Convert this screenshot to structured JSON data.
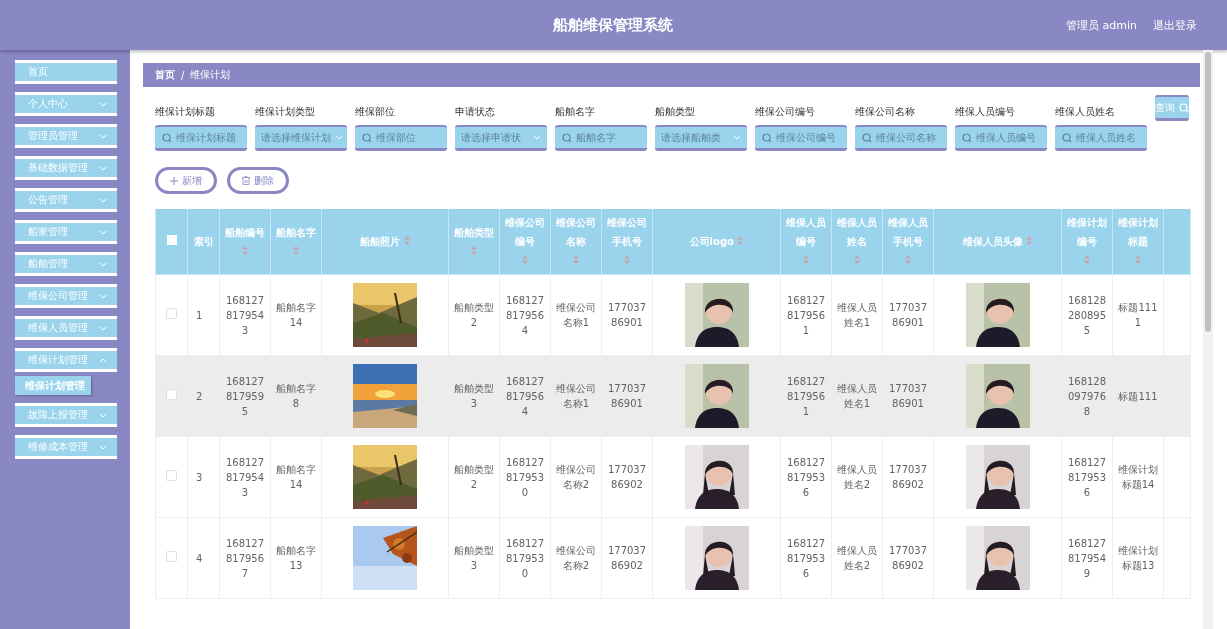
{
  "header": {
    "title": "船舶维保管理系统",
    "user": "管理员 admin",
    "logout": "退出登录"
  },
  "sidebar": {
    "items": [
      {
        "label": "首页",
        "kind": "link"
      },
      {
        "label": "个人中心",
        "kind": "group",
        "expanded": false
      },
      {
        "label": "管理员管理",
        "kind": "group",
        "expanded": false
      },
      {
        "label": "基础数据管理",
        "kind": "group",
        "expanded": false
      },
      {
        "label": "公告管理",
        "kind": "group",
        "expanded": false
      },
      {
        "label": "船家管理",
        "kind": "group",
        "expanded": false
      },
      {
        "label": "船舶管理",
        "kind": "group",
        "expanded": false
      },
      {
        "label": "维保公司管理",
        "kind": "group",
        "expanded": false
      },
      {
        "label": "维保人员管理",
        "kind": "group",
        "expanded": false
      },
      {
        "label": "维保计划管理",
        "kind": "group",
        "expanded": true,
        "children": [
          {
            "label": "维保计划管理",
            "selected": true
          }
        ]
      },
      {
        "label": "故障上报管理",
        "kind": "group",
        "expanded": false
      },
      {
        "label": "维修成本管理",
        "kind": "group",
        "expanded": false
      }
    ]
  },
  "breadcrumb": {
    "items": [
      "首页",
      "维保计划"
    ],
    "separator": "/"
  },
  "filters": [
    {
      "label": "维保计划标题",
      "kind": "input",
      "placeholder": "维保计划标题"
    },
    {
      "label": "维保计划类型",
      "kind": "select",
      "placeholder": "请选择维保计划"
    },
    {
      "label": "维保部位",
      "kind": "input",
      "placeholder": "维保部位"
    },
    {
      "label": "申请状态",
      "kind": "select",
      "placeholder": "请选择申请状"
    },
    {
      "label": "船舶名字",
      "kind": "input",
      "placeholder": "船舶名字"
    },
    {
      "label": "船舶类型",
      "kind": "select",
      "placeholder": "请选择船舶类"
    },
    {
      "label": "维保公司编号",
      "kind": "input",
      "placeholder": "维保公司编号"
    },
    {
      "label": "维保公司名称",
      "kind": "input",
      "placeholder": "维保公司名称"
    },
    {
      "label": "维保人员编号",
      "kind": "input",
      "placeholder": "维保人员编号"
    },
    {
      "label": "维保人员姓名",
      "kind": "input",
      "placeholder": "维保人员姓名"
    }
  ],
  "search_button": "查询",
  "actions": [
    {
      "label": "新增",
      "kind": "add"
    },
    {
      "label": "删除",
      "kind": "delete"
    }
  ],
  "table": {
    "select_all_checked": false,
    "index_header": "索引",
    "columns": [
      {
        "kind": "text",
        "label": "船舶编号"
      },
      {
        "kind": "text",
        "label": "船舶名字"
      },
      {
        "label": "船舶照片"
      },
      {
        "kind": "text",
        "label": "船舶类型"
      },
      {
        "kind": "text",
        "label": "维保公司编号"
      },
      {
        "kind": "text",
        "label": "维保公司名称"
      },
      {
        "kind": "text",
        "label": "维保公司手机号"
      },
      {
        "kind": "avatar",
        "label": "公司logo"
      },
      {
        "kind": "text",
        "label": "维保人员编号"
      },
      {
        "kind": "text",
        "label": "维保人员姓名"
      },
      {
        "kind": "text",
        "label": "维保人员手机号"
      },
      {
        "kind": "avatar",
        "label": "维保人员头像"
      },
      {
        "kind": "text",
        "label": "维保计划编号"
      },
      {
        "kind": "text",
        "label": "维保计划标题"
      }
    ],
    "rows": [
      {
        "index": "1",
        "checked": false,
        "highlighted": false,
        "cells": [
          "1681278179543",
          "船舶名字14",
          {
            "kind": "picture"
          },
          "船舶类型2",
          "1681278179564",
          "维保公司名称1",
          "17703786901",
          {
            "kind": "picture"
          },
          "1681278179561",
          "维保人员姓名1",
          "17703786901",
          {
            "kind": "picture"
          },
          "1681282808955",
          "标题1111"
        ]
      },
      {
        "index": "2",
        "checked": false,
        "highlighted": true,
        "cells": [
          "1681278179595",
          "船舶名字8",
          {
            "kind": "picture"
          },
          "船舶类型3",
          "1681278179564",
          "维保公司名称1",
          "17703786901",
          {
            "kind": "picture"
          },
          "1681278179561",
          "维保人员姓名1",
          "17703786901",
          {
            "kind": "picture"
          },
          "1681280979768",
          "标题111"
        ]
      },
      {
        "index": "3",
        "checked": false,
        "highlighted": false,
        "cells": [
          "1681278179543",
          "船舶名字14",
          {
            "kind": "picture"
          },
          "船舶类型2",
          "1681278179530",
          "维保公司名称2",
          "17703786902",
          {
            "kind": "picture"
          },
          "1681278179536",
          "维保人员姓名2",
          "17703786902",
          {
            "kind": "picture"
          },
          "1681278179536",
          "维保计划标题14"
        ]
      },
      {
        "index": "4",
        "checked": false,
        "highlighted": false,
        "cells": [
          "1681278179567",
          "船舶名字13",
          {
            "kind": "picture"
          },
          "船舶类型3",
          "1681278179530",
          "维保公司名称2",
          "17703786902",
          {
            "kind": "picture"
          },
          "1681278179536",
          "维保人员姓名2",
          "17703786902",
          {
            "kind": "picture"
          },
          "1681278179549",
          "维保计划标题13"
        ]
      }
    ]
  }
}
